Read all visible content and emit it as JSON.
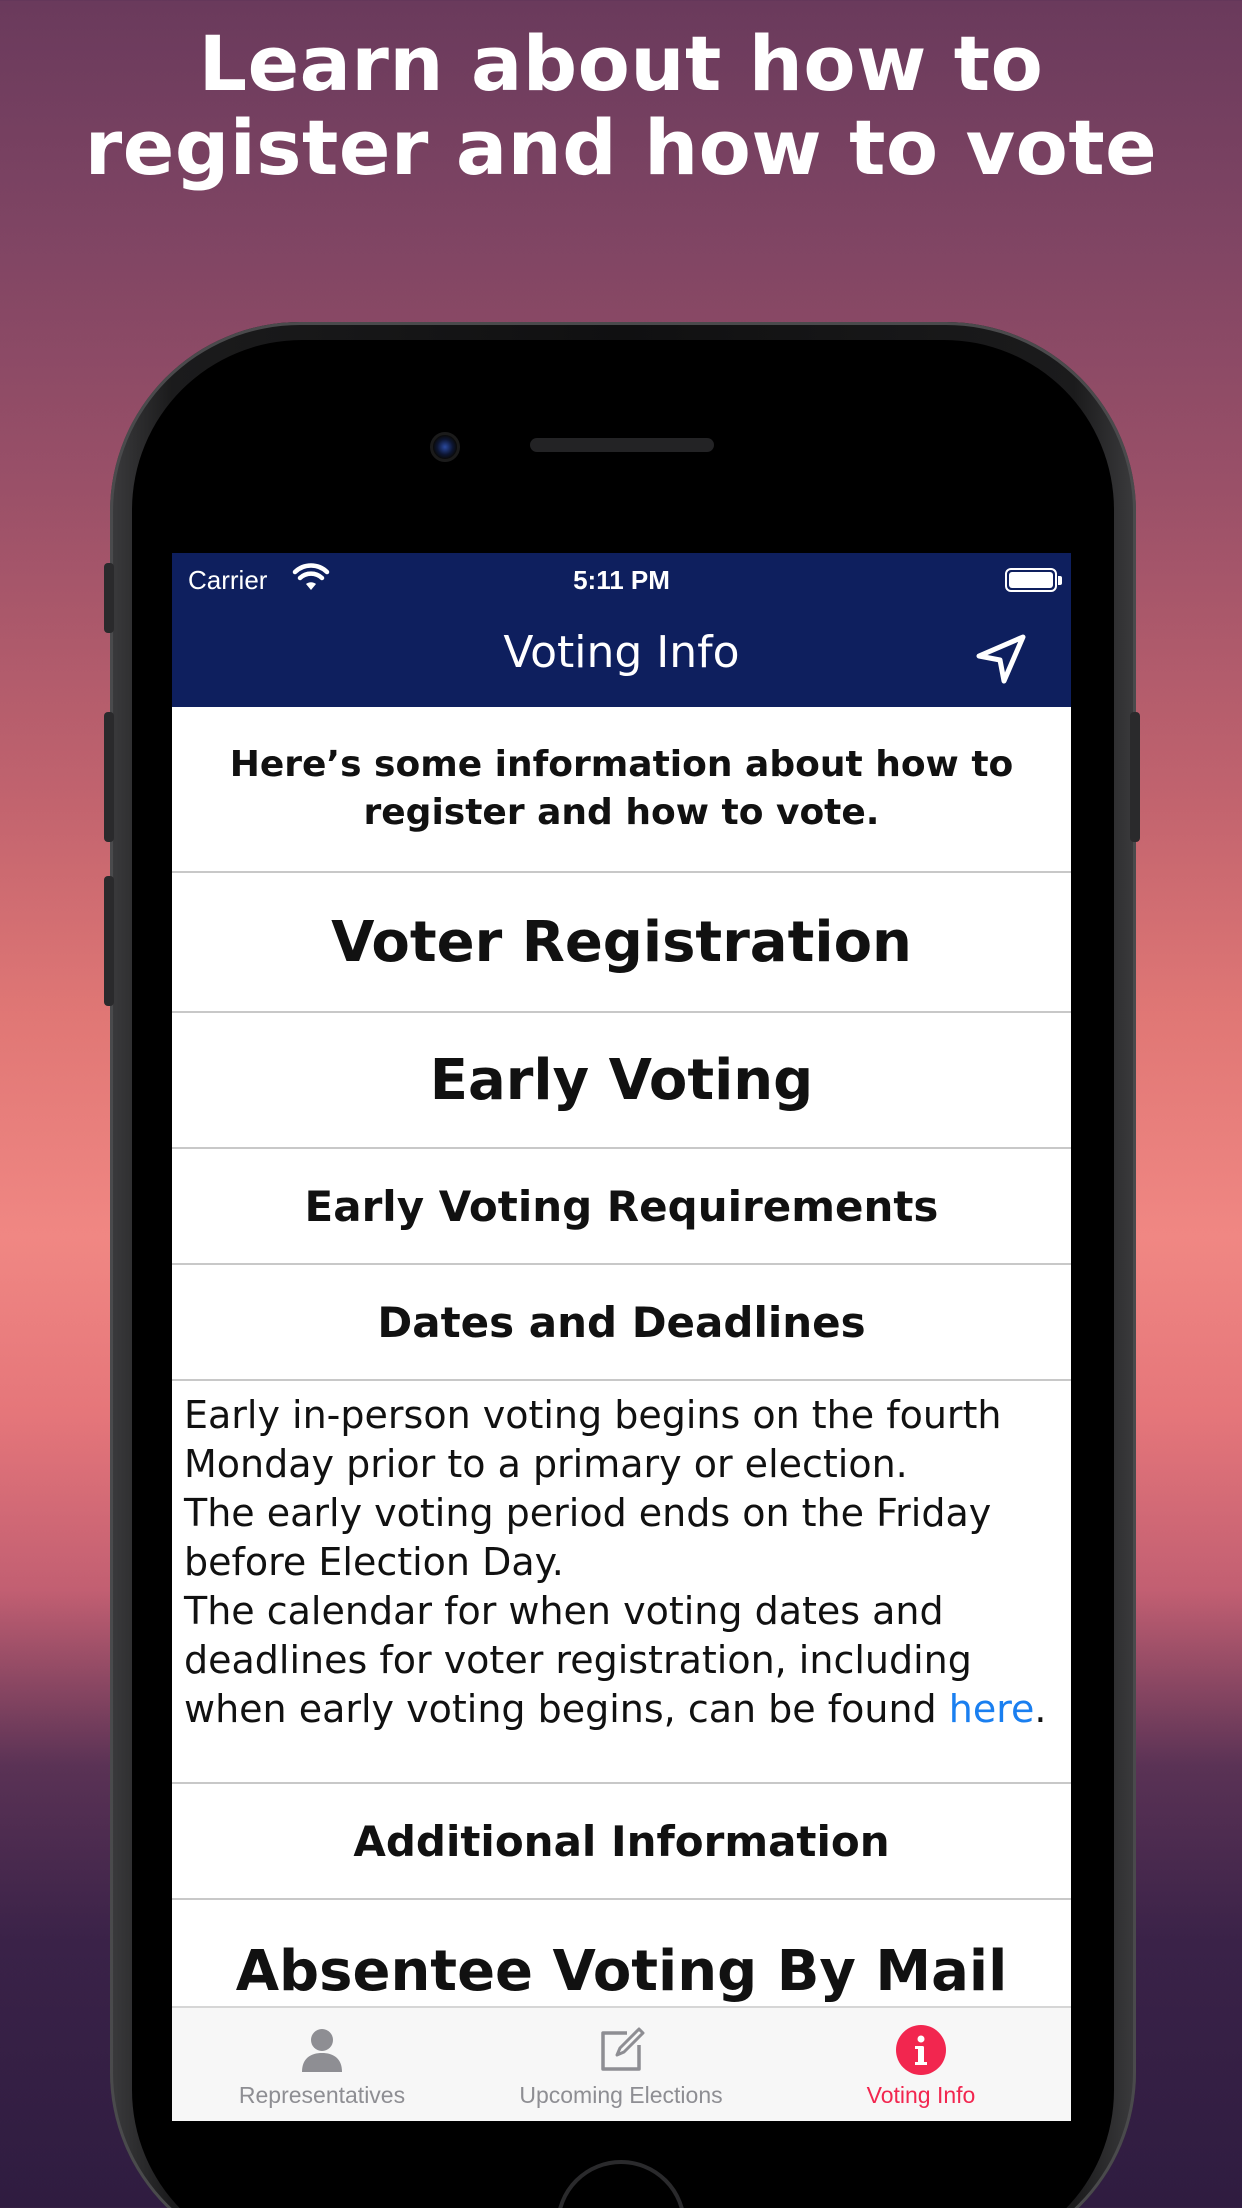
{
  "promo": {
    "headline_line1": "Learn about how to",
    "headline_line2": "register and how to vote"
  },
  "status_bar": {
    "carrier": "Carrier",
    "time": "5:11 PM",
    "wifi_icon": "wifi-icon",
    "battery_icon": "battery-icon"
  },
  "nav": {
    "title": "Voting Info",
    "location_icon": "location-arrow-icon",
    "bar_color": "#0e1f5e"
  },
  "content": {
    "intro_line1": "Here’s some information about how to",
    "intro_line2": "register and how to vote.",
    "voter_registration": "Voter Registration",
    "early_voting": "Early Voting",
    "early_voting_requirements": "Early Voting Requirements",
    "dates_and_deadlines": "Dates and Deadlines",
    "body_lines": [
      "Early in-person voting begins on the fourth",
      "Monday prior to a primary or election.",
      "The early voting period ends on the Friday",
      "before Election Day.",
      "The calendar for when voting dates and",
      "deadlines for voter registration, including"
    ],
    "body_last_prefix": "when early voting begins, can be found ",
    "body_link": "here",
    "body_last_suffix": ".",
    "additional_information": "Additional Information",
    "absentee_voting": "Absentee Voting By Mail"
  },
  "tabs": [
    {
      "label": "Representatives",
      "icon": "person-icon",
      "active": false
    },
    {
      "label": "Upcoming Elections",
      "icon": "edit-note-icon",
      "active": false
    },
    {
      "label": "Voting Info",
      "icon": "info-icon",
      "active": true
    }
  ],
  "colors": {
    "accent": "#f2264f",
    "link": "#1a7ff0"
  }
}
